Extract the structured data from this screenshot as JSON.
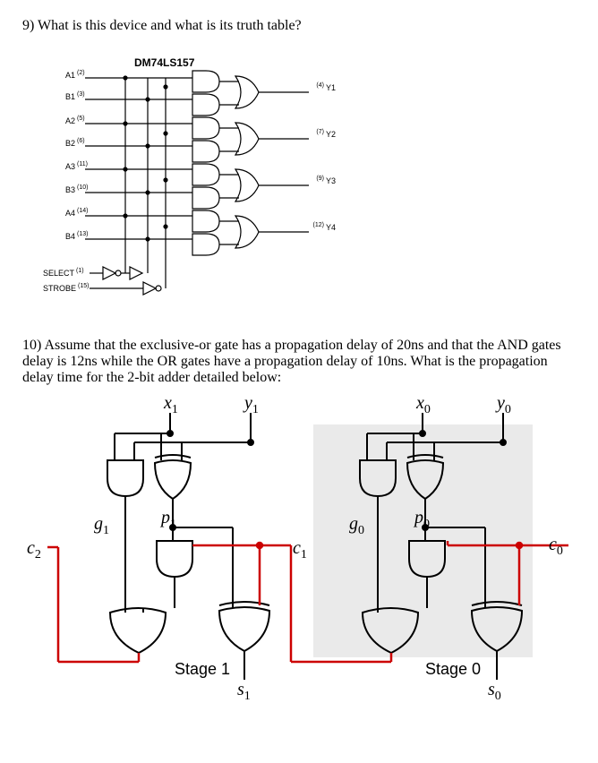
{
  "q9": {
    "number": "9)",
    "text": "What is this device and what is its truth table?",
    "chip": "DM74LS157",
    "pins_left": [
      {
        "name": "A1",
        "num": "(2)"
      },
      {
        "name": "B1",
        "num": "(3)"
      },
      {
        "name": "A2",
        "num": "(5)"
      },
      {
        "name": "B2",
        "num": "(6)"
      },
      {
        "name": "A3",
        "num": "(11)"
      },
      {
        "name": "B3",
        "num": "(10)"
      },
      {
        "name": "A4",
        "num": "(14)"
      },
      {
        "name": "B4",
        "num": "(13)"
      },
      {
        "name": "SELECT",
        "num": "(1)"
      },
      {
        "name": "STROBE",
        "num": "(15)"
      }
    ],
    "pins_right": [
      {
        "num": "(4)",
        "name": "Y1"
      },
      {
        "num": "(7)",
        "name": "Y2"
      },
      {
        "num": "(9)",
        "name": "Y3"
      },
      {
        "num": "(12)",
        "name": "Y4"
      }
    ]
  },
  "q10": {
    "number": "10)",
    "text": "Assume that the exclusive-or gate has a propagation delay of 20ns and that the AND gates delay is 12ns while the OR gates have a propagation delay of 10ns. What is the propagation delay time for the 2-bit adder detailed below:",
    "labels": {
      "x1": "x",
      "x1_sub": "1",
      "y1": "y",
      "y1_sub": "1",
      "x0": "x",
      "x0_sub": "0",
      "y0": "y",
      "y0_sub": "0",
      "g1": "g",
      "g1_sub": "1",
      "p1": "p",
      "p1_sub": "1",
      "g0": "g",
      "g0_sub": "0",
      "p0": "p",
      "p0_sub": "0",
      "c2": "c",
      "c2_sub": "2",
      "c1": "c",
      "c1_sub": "1",
      "c0": "c",
      "c0_sub": "0",
      "s1": "s",
      "s1_sub": "1",
      "s0": "s",
      "s0_sub": "0",
      "stage1": "Stage 1",
      "stage0": "Stage 0"
    }
  }
}
